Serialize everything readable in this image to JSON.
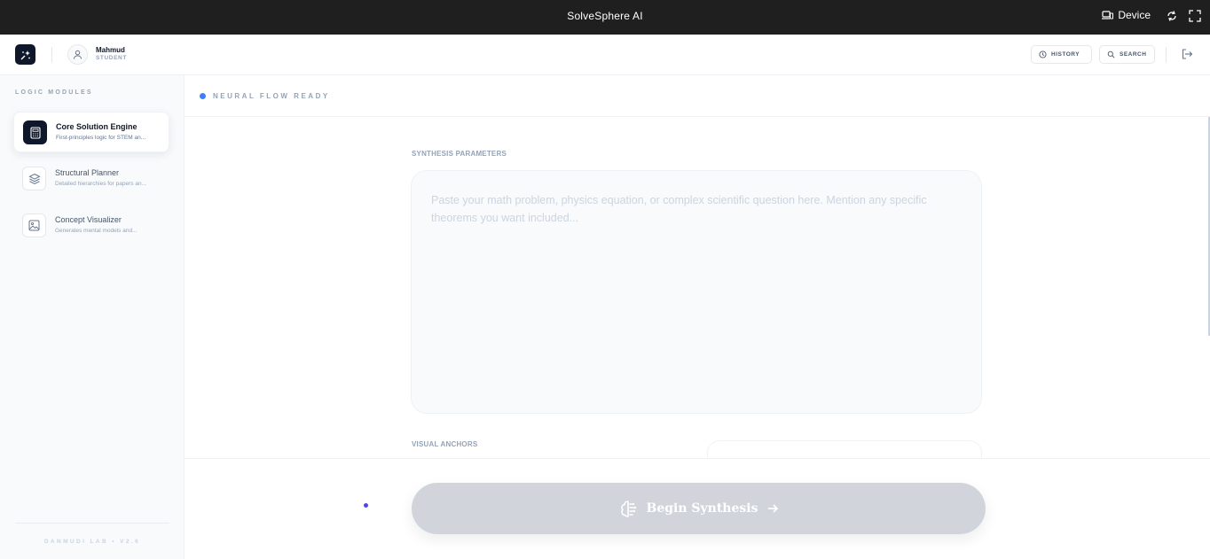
{
  "window": {
    "title": "SolveSphere AI",
    "device_label": "Device"
  },
  "header": {
    "user_name": "Mahmud",
    "user_role": "STUDENT",
    "history_label": "HISTORY",
    "search_label": "SEARCH"
  },
  "sidebar": {
    "title": "LOGIC MODULES",
    "modules": [
      {
        "title": "Core Solution Engine",
        "desc": "First-principles logic for STEM an...",
        "active": true,
        "icon": "calculator-icon"
      },
      {
        "title": "Structural Planner",
        "desc": "Detailed hierarchies for papers an...",
        "active": false,
        "icon": "layers-icon"
      },
      {
        "title": "Concept Visualizer",
        "desc": "Generates mental models and...",
        "active": false,
        "icon": "image-icon"
      }
    ],
    "footer": "DANMUDI LAB • V2.6"
  },
  "status": {
    "text": "NEURAL FLOW READY",
    "dot_color": "#3b82f6"
  },
  "main": {
    "params_label": "SYNTHESIS PARAMETERS",
    "prompt_placeholder": "Paste your math problem, physics equation, or complex scientific question here. Mention any specific theorems you want included...",
    "anchors_label": "VISUAL ANCHORS"
  },
  "action": {
    "begin_label": "Begin Synthesis",
    "button_color": "#d1d5db"
  }
}
